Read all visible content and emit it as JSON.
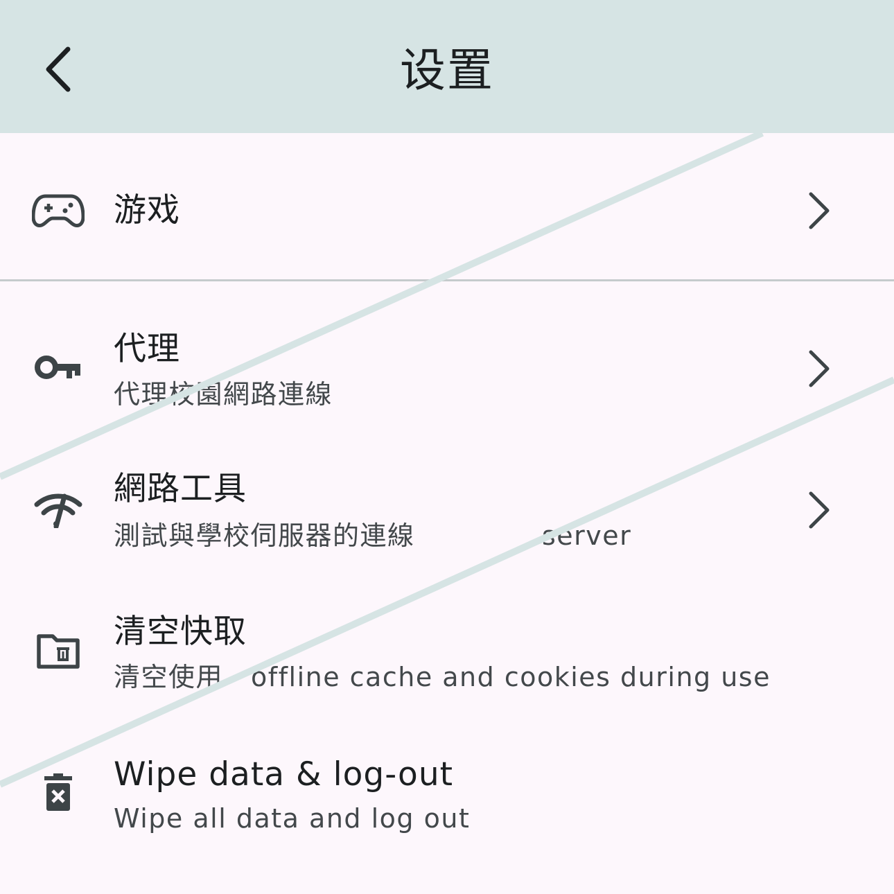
{
  "appbar": {
    "title": "设置",
    "back_icon": "chevron-left-icon",
    "background": "#d6e4e4"
  },
  "items": [
    {
      "icon": "gamepad-icon",
      "title": "游戏",
      "subtitle": "",
      "has_chevron": true
    },
    {
      "icon": "key-icon",
      "title": "代理",
      "subtitle": "代理校園網路連線",
      "has_chevron": true
    },
    {
      "icon": "network-check-icon",
      "title": "網路工具",
      "subtitle": "測試與學校伺服器的連線",
      "subtitle_overlay": "server",
      "has_chevron": true
    },
    {
      "icon": "folder-delete-icon",
      "title": "清空快取",
      "subtitle": "清空使用",
      "subtitle_overlay": "offline cache and cookies during use",
      "has_chevron": false
    },
    {
      "icon": "trash-x-icon",
      "title": "Wipe data & log-out",
      "subtitle": "Wipe all data and log out",
      "has_chevron": false
    }
  ],
  "colors": {
    "background": "#fdf7fc",
    "icon": "#3d4447",
    "divider": "#c5cbcc",
    "overlay_stripe": "#d6e4e4"
  }
}
